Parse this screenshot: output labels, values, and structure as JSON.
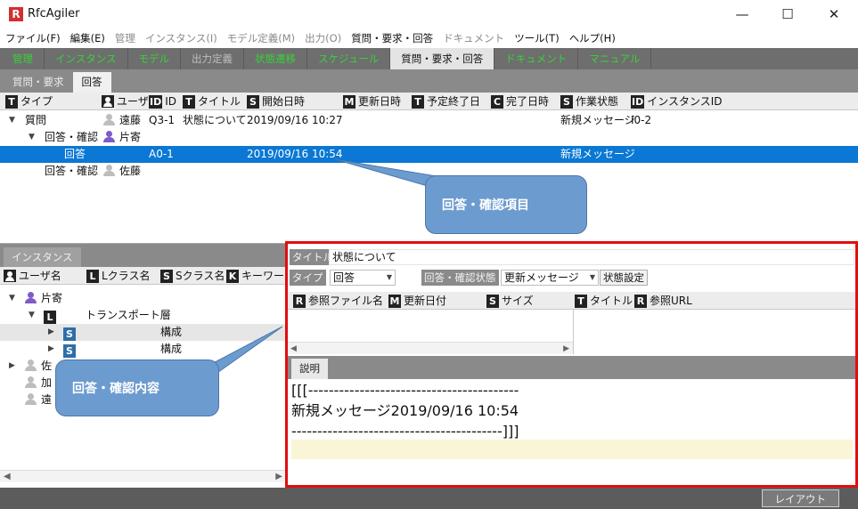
{
  "app": {
    "logo": "R",
    "title": "RfcAgiler",
    "window": {
      "minimize": "—",
      "maximize": "☐",
      "close": "✕"
    }
  },
  "menubar": [
    {
      "label": "ファイル(F)",
      "disabled": false
    },
    {
      "label": "編集(E)",
      "disabled": false
    },
    {
      "label": "管理",
      "disabled": true
    },
    {
      "label": "インスタンス(I)",
      "disabled": true
    },
    {
      "label": "モデル定義(M)",
      "disabled": true
    },
    {
      "label": "出力(O)",
      "disabled": true
    },
    {
      "label": "質問・要求・回答",
      "disabled": false
    },
    {
      "label": "ドキュメント",
      "disabled": true
    },
    {
      "label": "ツール(T)",
      "disabled": false
    },
    {
      "label": "ヘルプ(H)",
      "disabled": false
    }
  ],
  "tabs": [
    {
      "label": "管理",
      "state": "green"
    },
    {
      "label": "インスタンス",
      "state": "green"
    },
    {
      "label": "モデル",
      "state": "green"
    },
    {
      "label": "出力定義",
      "state": "dim"
    },
    {
      "label": "状態遷移",
      "state": "green"
    },
    {
      "label": "スケジュール",
      "state": "green"
    },
    {
      "label": "質問・要求・回答",
      "state": "active"
    },
    {
      "label": "ドキュメント",
      "state": "green"
    },
    {
      "label": "マニュアル",
      "state": "green"
    }
  ],
  "qa_subtabs": [
    {
      "label": "質問・要求",
      "active": false
    },
    {
      "label": "回答",
      "active": true
    }
  ],
  "qa_columns": [
    {
      "badge": "T",
      "label": "タイプ"
    },
    {
      "badge": "user",
      "label": "ユーザ"
    },
    {
      "badge": "ID",
      "label": "ID"
    },
    {
      "badge": "T",
      "label": "タイトル"
    },
    {
      "badge": "S",
      "label": "開始日時"
    },
    {
      "badge": "M",
      "label": "更新日時"
    },
    {
      "badge": "T",
      "label": "予定終了日"
    },
    {
      "badge": "C",
      "label": "完了日時"
    },
    {
      "badge": "S",
      "label": "作業状態"
    },
    {
      "badge": "ID",
      "label": "インスタンスID"
    }
  ],
  "qa_rows": [
    {
      "level": 0,
      "expand": "▼",
      "type": "質問",
      "user": "遠藤",
      "user_color": "gray",
      "id": "Q3-1",
      "title": "状態について",
      "start": "2019/09/16 10:27",
      "status": "新規メッセージ",
      "instance": "I0-2",
      "selected": false
    },
    {
      "level": 1,
      "expand": "▼",
      "type": "回答・確認",
      "user": "片寄",
      "user_color": "purple",
      "id": "",
      "title": "",
      "start": "",
      "status": "",
      "instance": "",
      "selected": false
    },
    {
      "level": 2,
      "expand": "",
      "type": "回答",
      "user": "",
      "user_color": "",
      "id": "A0-1",
      "title": "",
      "start": "2019/09/16 10:54",
      "status": "新規メッセージ",
      "instance": "",
      "selected": true
    },
    {
      "level": 1,
      "expand": "",
      "type": "回答・確認",
      "user": "佐藤",
      "user_color": "gray",
      "id": "",
      "title": "",
      "start": "",
      "status": "",
      "instance": "",
      "selected": false
    }
  ],
  "instance_panel": {
    "tab": "インスタンス",
    "columns": [
      {
        "badge": "user",
        "label": "ユーザ名"
      },
      {
        "badge": "L",
        "label": "Lクラス名"
      },
      {
        "badge": "S",
        "label": "Sクラス名"
      },
      {
        "badge": "K",
        "label": "キーワード"
      }
    ],
    "rows": [
      {
        "kind": "user",
        "expand": "▼",
        "text": "片寄",
        "color": "purple",
        "highlight": false
      },
      {
        "kind": "L",
        "expand": "▼",
        "badge": "L",
        "text": "トランスポート層",
        "highlight": false
      },
      {
        "kind": "S",
        "expand": "▶",
        "badge": "S",
        "text": "構成",
        "highlight": true
      },
      {
        "kind": "S",
        "expand": "▶",
        "badge": "S",
        "text": "構成",
        "highlight": false
      },
      {
        "kind": "user",
        "expand": "▶",
        "text": "佐",
        "color": "gray",
        "highlight": false
      },
      {
        "kind": "user",
        "expand": "",
        "text": "加",
        "color": "gray",
        "highlight": false
      },
      {
        "kind": "user",
        "expand": "",
        "text": "遠",
        "color": "gray",
        "highlight": false
      }
    ]
  },
  "detail": {
    "title_label": "タイトル",
    "title_value": "状態について",
    "type_label": "タイプ",
    "type_value": "回答",
    "status_label": "回答・確認状態",
    "status_value": "更新メッセージ",
    "status_button": "状態設定",
    "file_columns": [
      {
        "badge": "R",
        "label": "参照ファイル名"
      },
      {
        "badge": "M",
        "label": "更新日付"
      },
      {
        "badge": "S",
        "label": "サイズ"
      },
      {
        "badge": "T",
        "label": "タイトル"
      },
      {
        "badge": "R",
        "label": "参照URL"
      }
    ],
    "desc_tab": "説明",
    "desc_lines": [
      "[[[-----------------------------------------",
      "新規メッセージ2019/09/16 10:54",
      "-----------------------------------------]]]"
    ]
  },
  "statusbar": {
    "layout_button": "レイアウト"
  },
  "callouts": [
    {
      "text": "回答・確認項目"
    },
    {
      "text": "回答・確認内容"
    }
  ]
}
